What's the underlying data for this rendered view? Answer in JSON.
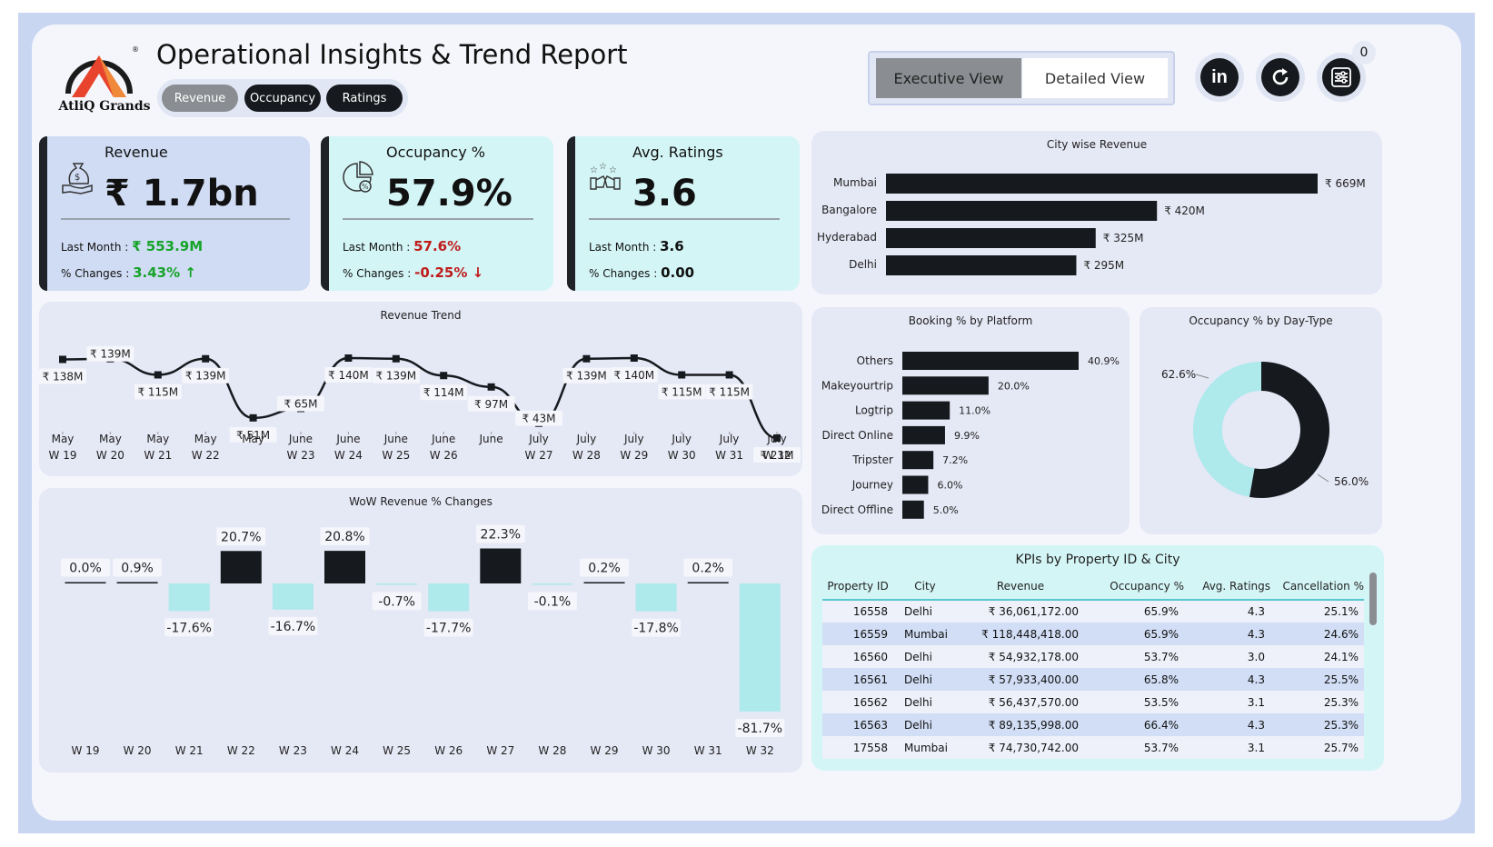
{
  "header": {
    "title": "Operational Insights & Trend Report",
    "logo_text": "AtliQ Grands",
    "pills": [
      "Revenue",
      "Occupancy",
      "Ratings"
    ],
    "views": {
      "executive": "Executive View",
      "detailed": "Detailed View"
    },
    "notification_count": "0",
    "icons": [
      "linkedin-icon",
      "refresh-icon",
      "filter-settings-icon"
    ]
  },
  "kpis": [
    {
      "label": "Revenue",
      "value": "₹ 1.7bn",
      "last_month_label": "Last Month : ",
      "last_month": "₹ 553.9M",
      "change_label": "% Changes : ",
      "change": "3.43% ↑",
      "color": "#17a32a",
      "icon": "money-bag-hand-icon",
      "bg": "#d0dcf4"
    },
    {
      "label": "Occupancy %",
      "value": "57.9%",
      "last_month_label": "Last Month : ",
      "last_month": "57.6%",
      "change_label": "% Changes : ",
      "change": "-0.25% ↓",
      "color": "#c01b1b",
      "icon": "pie-percent-icon",
      "bg": "#d4f5f6"
    },
    {
      "label": "Avg. Ratings",
      "value": "3.6",
      "last_month_label": "Last Month : ",
      "last_month": "3.6",
      "change_label": "% Changes : ",
      "change": "0.00",
      "color": "#111111",
      "icon": "rating-stars-icon",
      "bg": "#d4f5f6"
    }
  ],
  "city_revenue": {
    "title": "City wise Revenue",
    "cities": [
      "Mumbai",
      "Bangalore",
      "Hyderabad",
      "Delhi"
    ],
    "values": [
      669,
      420,
      325,
      295
    ],
    "labels": [
      "₹ 669M",
      "₹ 420M",
      "₹ 325M",
      "₹ 295M"
    ]
  },
  "revenue_trend": {
    "title": "Revenue Trend",
    "weeks": [
      "W 19",
      "W 20",
      "W 21",
      "W 22",
      "W 23",
      "W 24",
      "W 25",
      "W 26",
      "W 27",
      "W 28",
      "W 29",
      "W 30",
      "W 31",
      "W 32"
    ],
    "x_labels": [
      [
        "May",
        "W 19"
      ],
      [
        "May",
        "W 20"
      ],
      [
        "May",
        "W 21"
      ],
      [
        "May",
        "W 22"
      ],
      [
        "May",
        ""
      ],
      [
        "June",
        "W 23"
      ],
      [
        "June",
        "W 24"
      ],
      [
        "June",
        "W 25"
      ],
      [
        "June",
        "W 26"
      ],
      [
        "June",
        ""
      ],
      [
        "July",
        "W 27"
      ],
      [
        "July",
        "W 28"
      ],
      [
        "July",
        "W 29"
      ],
      [
        "July",
        "W 30"
      ],
      [
        "July",
        "W 31"
      ],
      [
        "July",
        "W 32"
      ]
    ],
    "point_labels": [
      "₹ 138M",
      "₹ 139M",
      "₹ 115M",
      "₹ 139M",
      "₹ 51M",
      "₹ 65M",
      "₹ 140M",
      "₹ 139M",
      "₹ 114M",
      "₹ 97M",
      "₹ 43M",
      "₹ 139M",
      "₹ 140M",
      "₹ 115M",
      "₹ 115M",
      "₹ 21M"
    ],
    "values": [
      138,
      139,
      115,
      139,
      51,
      65,
      140,
      139,
      114,
      97,
      43,
      139,
      140,
      115,
      115,
      21
    ]
  },
  "wow": {
    "title": "WoW Revenue % Changes",
    "weeks": [
      "W 19",
      "W 20",
      "W 21",
      "W 22",
      "W 23",
      "W 24",
      "W 25",
      "W 26",
      "W 27",
      "W 28",
      "W 29",
      "W 30",
      "W 31",
      "W 32"
    ],
    "values": [
      0.0,
      0.9,
      -17.6,
      20.7,
      -16.7,
      20.8,
      -0.7,
      -17.7,
      22.3,
      -0.1,
      0.2,
      -17.8,
      0.2,
      -81.7
    ],
    "labels": [
      "0.0%",
      "0.9%",
      "-17.6%",
      "20.7%",
      "-16.7%",
      "20.8%",
      "-0.7%",
      "-17.7%",
      "22.3%",
      "-0.1%",
      "0.2%",
      "-17.8%",
      "0.2%",
      "-81.7%"
    ]
  },
  "booking_platform": {
    "title": "Booking % by Platform",
    "platforms": [
      "Others",
      "Makeyourtrip",
      "Logtrip",
      "Direct Online",
      "Tripster",
      "Journey",
      "Direct Offline"
    ],
    "values": [
      40.9,
      20.0,
      11.0,
      9.9,
      7.2,
      6.0,
      5.0
    ],
    "labels": [
      "40.9%",
      "20.0%",
      "11.0%",
      "9.9%",
      "7.2%",
      "6.0%",
      "5.0%"
    ]
  },
  "occupancy_daytype": {
    "title": "Occupancy % by Day-Type",
    "values": [
      62.6,
      56.0
    ],
    "labels": [
      "62.6%",
      "56.0%"
    ],
    "colors": [
      "#16191d",
      "#aee9ec"
    ]
  },
  "kpi_table": {
    "title": "KPIs by Property ID & City",
    "columns": [
      "Property ID",
      "City",
      "Revenue",
      "Occupancy %",
      "Avg. Ratings",
      "Cancellation %"
    ],
    "rows": [
      [
        "16558",
        "Delhi",
        "₹ 36,061,172.00",
        "65.9%",
        "4.3",
        "25.1%"
      ],
      [
        "16559",
        "Mumbai",
        "₹ 118,448,418.00",
        "65.9%",
        "4.3",
        "24.6%"
      ],
      [
        "16560",
        "Delhi",
        "₹ 54,932,178.00",
        "53.7%",
        "3.0",
        "24.1%"
      ],
      [
        "16561",
        "Delhi",
        "₹ 57,933,400.00",
        "65.8%",
        "4.3",
        "25.5%"
      ],
      [
        "16562",
        "Delhi",
        "₹ 56,437,570.00",
        "53.5%",
        "3.1",
        "25.3%"
      ],
      [
        "16563",
        "Delhi",
        "₹ 89,135,998.00",
        "66.4%",
        "4.3",
        "25.3%"
      ],
      [
        "17558",
        "Mumbai",
        "₹ 74,730,742.00",
        "53.7%",
        "3.1",
        "25.7%"
      ]
    ]
  },
  "colors": {
    "dark": "#16191d",
    "teal": "#aee9ec",
    "card": "#e5e8f5",
    "frame": "#c9d6f2"
  }
}
